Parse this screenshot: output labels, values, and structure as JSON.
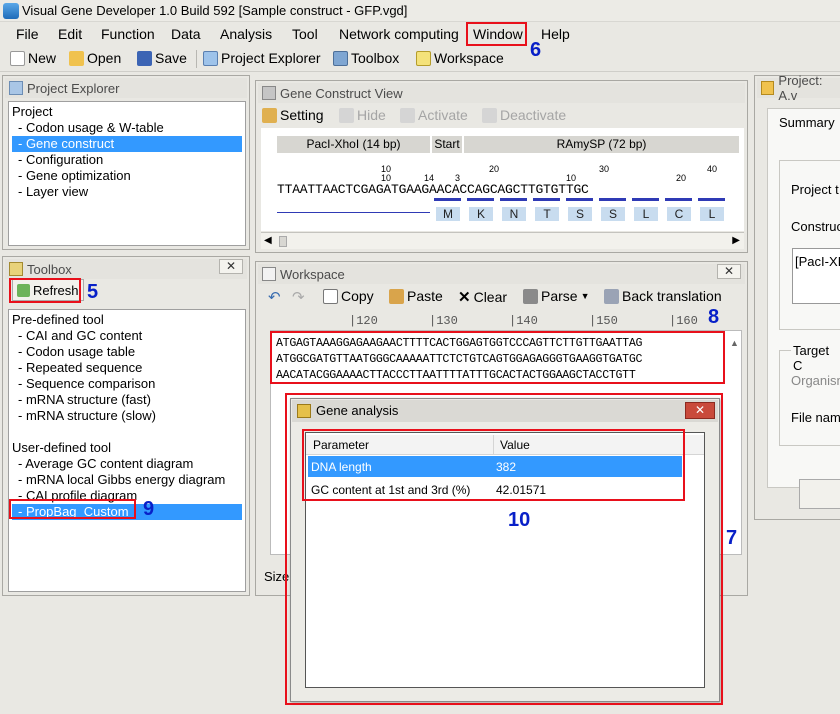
{
  "window": {
    "title": "Visual Gene Developer 1.0 Build 592    [Sample construct - GFP.vgd]"
  },
  "menu": [
    "File",
    "Edit",
    "Function",
    "Data",
    "Analysis",
    "Tool",
    "Network computing",
    "Window",
    "Help"
  ],
  "toolbar": {
    "new": "New",
    "open": "Open",
    "save": "Save",
    "project_explorer": "Project Explorer",
    "toolbox": "Toolbox",
    "workspace": "Workspace"
  },
  "callouts": {
    "c5": "5",
    "c6": "6",
    "c7": "7",
    "c8": "8",
    "c9": "9",
    "c10": "10"
  },
  "project_explorer": {
    "title": "Project Explorer",
    "root": "Project",
    "items": [
      "- Codon usage & W-table",
      "- Gene construct",
      "- Configuration",
      "- Gene optimization",
      "- Layer view"
    ],
    "selected_index": 1
  },
  "toolbox": {
    "title": "Toolbox",
    "refresh": "Refresh",
    "predefined_header": "Pre-defined tool",
    "predefined": [
      "- CAI and GC content",
      "- Codon usage table",
      "- Repeated sequence",
      "- Sequence comparison",
      "- mRNA structure (fast)",
      "- mRNA structure (slow)"
    ],
    "userdefined_header": "User-defined tool",
    "userdefined": [
      "- Average GC content diagram",
      "- mRNA local Gibbs energy diagram",
      "- CAI profile diagram",
      "- PropBag_Custom"
    ],
    "selected": "- PropBag_Custom"
  },
  "gene_construct": {
    "title": "Gene Construct View",
    "setting": "Setting",
    "hide": "Hide",
    "activate": "Activate",
    "deactivate": "Deactivate",
    "tab1": "PacI-XhoI (14 bp)",
    "tab2": "Start",
    "tab3": "RAmySP (72 bp)",
    "ruler_top": [
      "10",
      "20",
      "30",
      "40"
    ],
    "ruler_mid": [
      "10",
      "14",
      "3",
      "10",
      "20"
    ],
    "ruler_mid2": [
      "10"
    ],
    "sequence": "TTAATTAACTCGAGATGAAGAACACCAGCAGCTTGTGTTGC",
    "amino_acids": [
      "M",
      "K",
      "N",
      "T",
      "S",
      "S",
      "L",
      "C",
      "L"
    ]
  },
  "workspace": {
    "title": "Workspace",
    "copy": "Copy",
    "paste": "Paste",
    "clear": "Clear",
    "parse": "Parse",
    "back_translation": "Back translation",
    "ruler": [
      "|120",
      "|130",
      "|140",
      "|150",
      "|160"
    ],
    "lines": [
      "ATGAGTAAAGGAGAAGAACTTTTCACTGGAGTGGTCCCAGTTCTTGTTGAATTAG",
      "ATGGCGATGTTAATGGGCAAAAATTCTCTGTCAGTGGAGAGGGTGAAGGTGATGC",
      "AACATACGGAAAACTTACCCTTAATTTTATTTGCACTACTGGAAGCTACCTGTT"
    ],
    "size_label": "Size"
  },
  "gene_analysis": {
    "title": "Gene analysis",
    "columns": [
      "Parameter",
      "Value"
    ],
    "rows": [
      {
        "param": "DNA length",
        "value": "382"
      },
      {
        "param": "GC content at 1st and 3rd (%)",
        "value": "42.01571"
      }
    ]
  },
  "project_panel": {
    "title": "Project:  A.v",
    "tab": "Summary",
    "project_label": "Project t",
    "construct_label": "Construc",
    "construct_value": "[PacI-XI",
    "target_label": "Target C",
    "organism_label": "Organism",
    "filename_label": "File nam"
  }
}
